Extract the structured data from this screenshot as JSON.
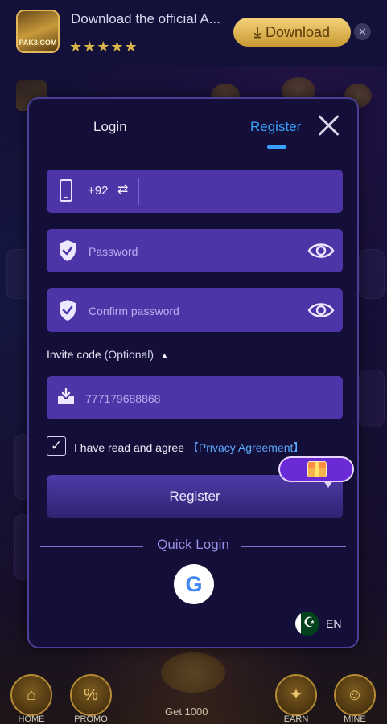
{
  "banner": {
    "title": "Download the official A...",
    "stars": "★★★★★",
    "logo_text": "PAK3.COM",
    "download_label": "Download",
    "close_glyph": "✕"
  },
  "modal": {
    "tabs": {
      "login": "Login",
      "register": "Register",
      "active": "Register"
    },
    "phone": {
      "country_code": "+92",
      "placeholder": "__________"
    },
    "password": {
      "placeholder": "Password"
    },
    "confirm_password": {
      "placeholder": "Confirm password"
    },
    "invite": {
      "label": "Invite code",
      "optional": "(Optional)",
      "value": "777179688868"
    },
    "agree": {
      "text": "I have read and agree",
      "link": "【Privacy Agreement】",
      "checked": true
    },
    "register_button": "Register",
    "quick_login": "Quick Login",
    "language": "EN"
  },
  "bottom_nav": {
    "items": [
      {
        "label": "HOME",
        "icon": "home-icon"
      },
      {
        "label": "PROMO",
        "icon": "promo-icon"
      },
      {
        "label": "EARN",
        "icon": "gift-icon"
      },
      {
        "label": "MINE",
        "icon": "profile-icon"
      }
    ],
    "bonus_text": "Get 1000"
  },
  "colors": {
    "accent_blue": "#39a0ff",
    "field_purple": "#4d35a8",
    "modal_bg": "#130f38",
    "link_blue": "#5ea8ff"
  }
}
